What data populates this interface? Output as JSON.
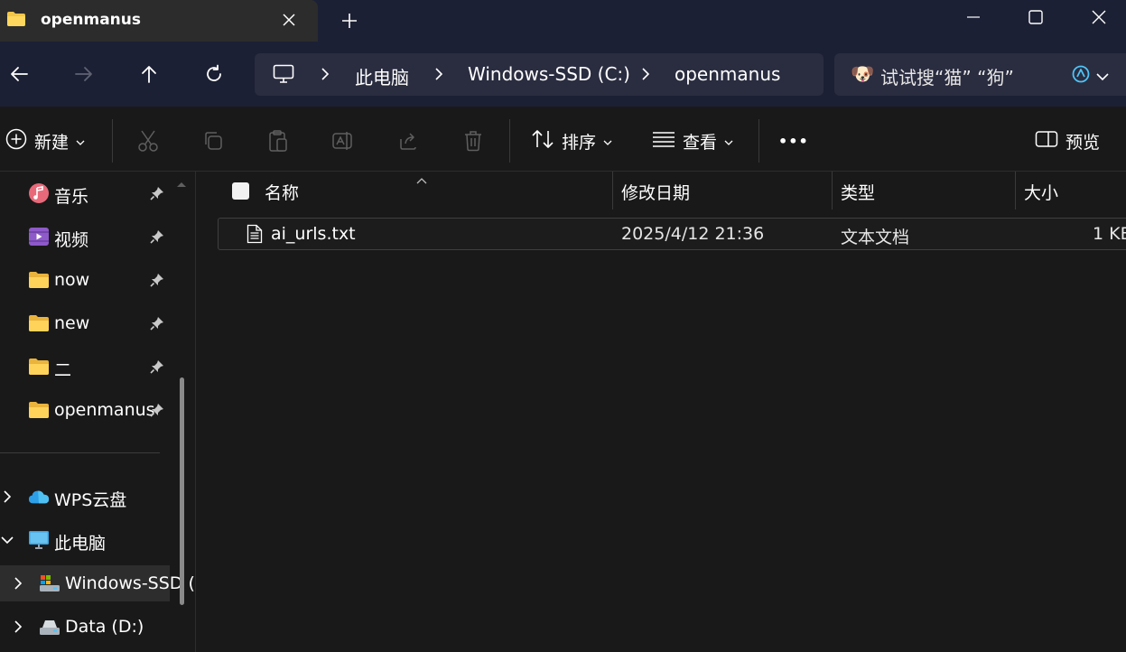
{
  "tab": {
    "title": "openmanus",
    "folder_icon": "folder-icon",
    "close_icon": "close-icon",
    "new_tab_icon": "plus-icon"
  },
  "window_controls": [
    "minimize-icon",
    "maximize-icon",
    "close-icon"
  ],
  "nav": {
    "back_icon": "arrow-left-icon",
    "forward_icon": "arrow-right-icon",
    "up_icon": "arrow-up-icon",
    "refresh_icon": "refresh-icon"
  },
  "address": {
    "root_icon": "monitor-icon",
    "crumbs": [
      "此电脑",
      "Windows-SSD (C:)",
      "openmanus"
    ]
  },
  "search": {
    "emoji": "🐶",
    "text": "试试搜“猫” “狗”",
    "copilot_icon": "copilot-icon",
    "dropdown_icon": "chevron-down-icon"
  },
  "commands": {
    "new_label": "新建",
    "sort_label": "排序",
    "view_label": "查看",
    "more_label": "•••",
    "preview_label": "预览"
  },
  "sidebar": {
    "pinned": [
      {
        "label": "音乐",
        "icon": "music-icon"
      },
      {
        "label": "视频",
        "icon": "video-icon"
      },
      {
        "label": "now",
        "icon": "folder-icon"
      },
      {
        "label": "new",
        "icon": "folder-icon"
      },
      {
        "label": "二",
        "icon": "folder-icon"
      },
      {
        "label": "openmanus",
        "icon": "folder-icon"
      }
    ],
    "tree": [
      {
        "label": "WPS云盘",
        "icon": "cloud-icon",
        "expanded": false
      },
      {
        "label": "此电脑",
        "icon": "monitor-icon",
        "expanded": true
      },
      {
        "label": "Windows-SSD (C:)",
        "icon": "drive-icon",
        "expanded": false,
        "selected": true
      },
      {
        "label": "Data (D:)",
        "icon": "drive-icon",
        "expanded": false
      }
    ]
  },
  "columns": {
    "name": "名称",
    "modified": "修改日期",
    "type": "类型",
    "size": "大小"
  },
  "files": [
    {
      "name": "ai_urls.txt",
      "modified": "2025/4/12 21:36",
      "type": "文本文档",
      "size": "1 KB",
      "icon": "text-file-icon"
    }
  ],
  "colors": {
    "titlebar": "#1c2034",
    "tab_active": "#2c2c2c",
    "address_bg": "#2a2d40",
    "background": "#191919",
    "folder": "#f3c649"
  }
}
